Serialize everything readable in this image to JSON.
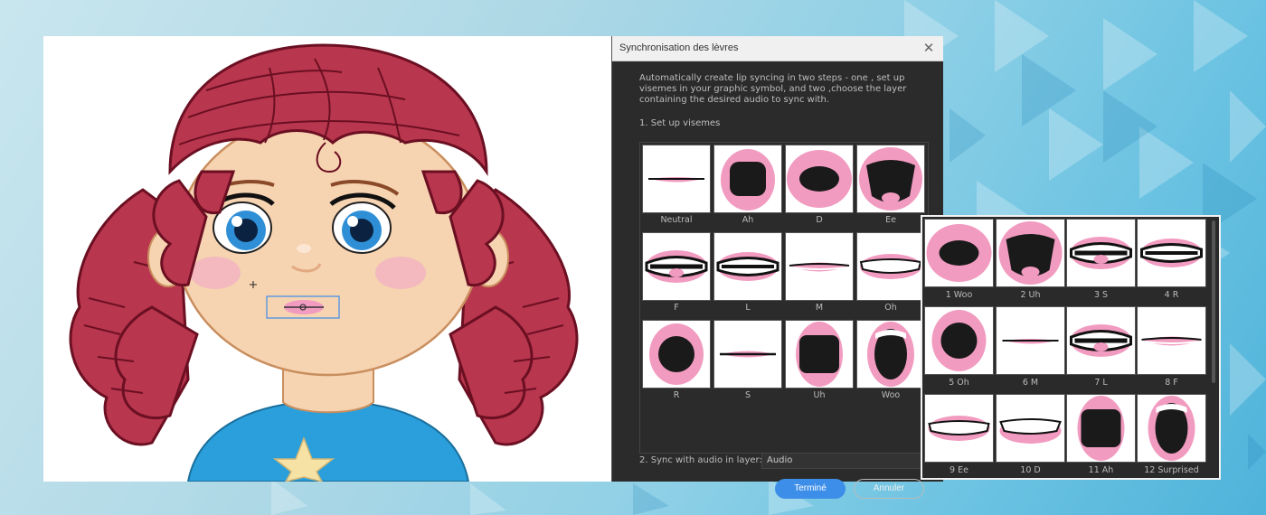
{
  "dialog": {
    "title": "Synchronisation des lèvres",
    "close_glyph": "✕",
    "description": "Automatically create lip syncing in two steps - one , set up visemes in your graphic symbol, and two ,choose the layer containing the desired audio to sync with.",
    "step1_label": "1. Set up visemes",
    "step2_label": "2. Sync with audio in layer:",
    "audio_layer": "Audio",
    "ok_label": "Terminé",
    "cancel_label": "Annuler",
    "visemes": [
      {
        "label": "Neutral",
        "shape": "neutral"
      },
      {
        "label": "Ah",
        "shape": "ah"
      },
      {
        "label": "D",
        "shape": "d"
      },
      {
        "label": "Ee",
        "shape": "ee"
      },
      {
        "label": "F",
        "shape": "f"
      },
      {
        "label": "L",
        "shape": "l"
      },
      {
        "label": "M",
        "shape": "m"
      },
      {
        "label": "Oh",
        "shape": "oh"
      },
      {
        "label": "R",
        "shape": "r"
      },
      {
        "label": "S",
        "shape": "s"
      },
      {
        "label": "Uh",
        "shape": "uh"
      },
      {
        "label": "Woo",
        "shape": "woo"
      }
    ]
  },
  "mouth_library": {
    "items": [
      {
        "label": "1 Woo",
        "shape": "d"
      },
      {
        "label": "2 Uh",
        "shape": "ee"
      },
      {
        "label": "3 S",
        "shape": "f"
      },
      {
        "label": "4 R",
        "shape": "l"
      },
      {
        "label": "5 Oh",
        "shape": "r"
      },
      {
        "label": "6 M",
        "shape": "neutral"
      },
      {
        "label": "7 L",
        "shape": "f"
      },
      {
        "label": "8 F",
        "shape": "m"
      },
      {
        "label": "9 Ee",
        "shape": "oh"
      },
      {
        "label": "10 D",
        "shape": "ss"
      },
      {
        "label": "11 Ah",
        "shape": "uh"
      },
      {
        "label": "12 Surprised",
        "shape": "woo"
      }
    ]
  },
  "colors": {
    "lip_pink": "#f29bc0",
    "mouth_dark": "#1a1a1a",
    "hair": "#b8364e",
    "hair_outline": "#6b0f22",
    "skin": "#f6d3b1",
    "shirt": "#2a9fdc",
    "star": "#f7e2a5",
    "accent_blue": "#3d8ee8"
  }
}
